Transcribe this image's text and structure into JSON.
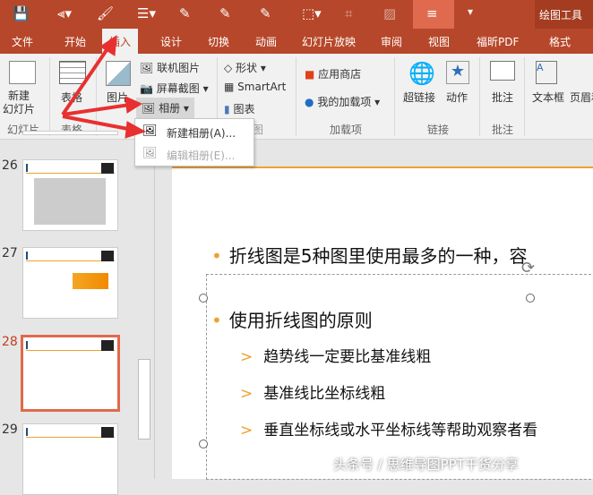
{
  "quick_access": {
    "context_tool": "绘图工具"
  },
  "tabs": [
    "文件",
    "开始",
    "插入",
    "设计",
    "切换",
    "动画",
    "幻灯片放映",
    "审阅",
    "视图",
    "福昕PDF",
    "格式"
  ],
  "active_tab": "插入",
  "ribbon": {
    "new_slide": "新建\n幻灯片",
    "table": "表格",
    "picture": "图片",
    "online_picture": "联机图片",
    "screenshot": "屏幕截图",
    "album": "相册",
    "shapes": "形状",
    "smartart": "SmartArt",
    "chart": "图表",
    "store": "应用商店",
    "my_addins": "我的加载项",
    "hyperlink": "超链接",
    "action": "动作",
    "comment": "批注",
    "textbox": "文本框",
    "header": "页眉和",
    "groups": [
      "幻灯片",
      "表格",
      "插图",
      "加载项",
      "链接",
      "批注"
    ]
  },
  "album_menu": {
    "new": "新建相册(A)...",
    "edit": "编辑相册(E)..."
  },
  "slides": [
    {
      "num": "26"
    },
    {
      "num": "27"
    },
    {
      "num": "28",
      "selected": true
    },
    {
      "num": "29"
    }
  ],
  "slide_content": {
    "bullet1": "折线图是5种图里使用最多的一种，容",
    "bullet2": "使用折线图的原则",
    "sub": [
      "趋势线一定要比基准线粗",
      "基准线比坐标线粗",
      "垂直坐标线或水平坐标线等帮助观察者看"
    ]
  },
  "watermark": "头条号 / 思维导图PPT干货分享",
  "colors": {
    "accent": "#b7472a",
    "orange": "#f0a030"
  }
}
